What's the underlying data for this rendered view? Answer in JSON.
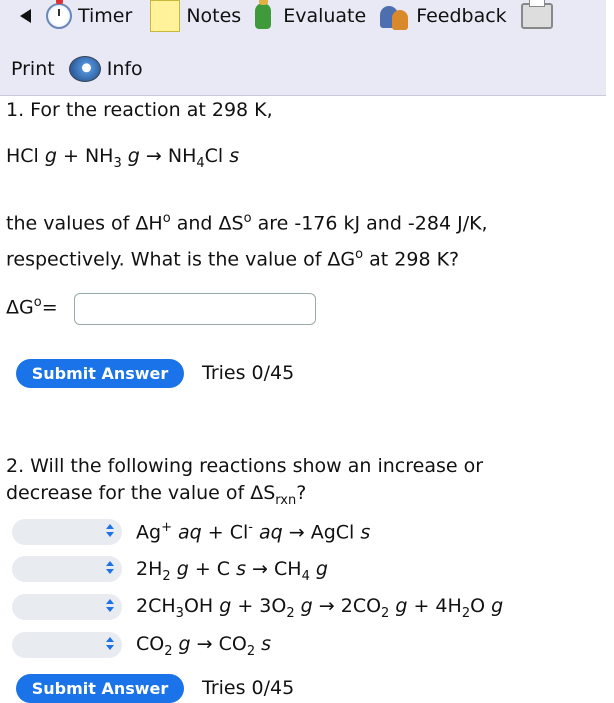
{
  "toolbar": {
    "timer": "Timer",
    "notes": "Notes",
    "evaluate": "Evaluate",
    "feedback": "Feedback",
    "print": "Print",
    "info": "Info"
  },
  "q1": {
    "intro": "1. For the reaction at 298 K,",
    "reaction": {
      "r1": "HCl",
      "p1": "g",
      "plus": "+",
      "r2a": "NH",
      "r2sub": "3",
      "p2": "g",
      "arrow": "→",
      "prod": "NH",
      "prodsub": "4",
      "prod2": "Cl",
      "p3": "s"
    },
    "line1a": "the values of ΔH",
    "deg": "o",
    "line1b": " and ΔS",
    "line1c": " are -176 kJ and -284 J/K,",
    "line2a": "respectively. What is the value of ΔG",
    "line2b": " at 298 K?",
    "label_a": "ΔG",
    "label_b": "=",
    "answer_value": "",
    "submit": "Submit Answer",
    "tries": "Tries 0/45"
  },
  "q2": {
    "line1": "2. Will the following reactions show an increase or",
    "line2a": "decrease for the value of ΔS",
    "line2sub": "rxn",
    "line2b": "?",
    "reactions": [
      {
        "parts": [
          "Ag",
          "+",
          " aq",
          " + Cl",
          "-",
          " aq",
          " → AgCl",
          " s"
        ]
      },
      {
        "parts": [
          "2H",
          "2",
          " g",
          " + C",
          " s",
          " → CH",
          "4",
          " g"
        ]
      },
      {
        "parts": [
          "2CH",
          "3",
          "OH",
          " g",
          " + 3O",
          "2",
          " g",
          " → 2CO",
          "2",
          " g",
          " + 4H",
          "2",
          "O",
          " g"
        ]
      },
      {
        "parts": [
          "CO",
          "2",
          " g",
          " → CO",
          "2",
          " s"
        ]
      }
    ],
    "selected": [
      "",
      "",
      "",
      ""
    ],
    "submit": "Submit Answer",
    "tries": "Tries 0/45"
  },
  "colors": {
    "accent": "#1a73e8",
    "toolbar_bg": "#e9e9f6"
  }
}
